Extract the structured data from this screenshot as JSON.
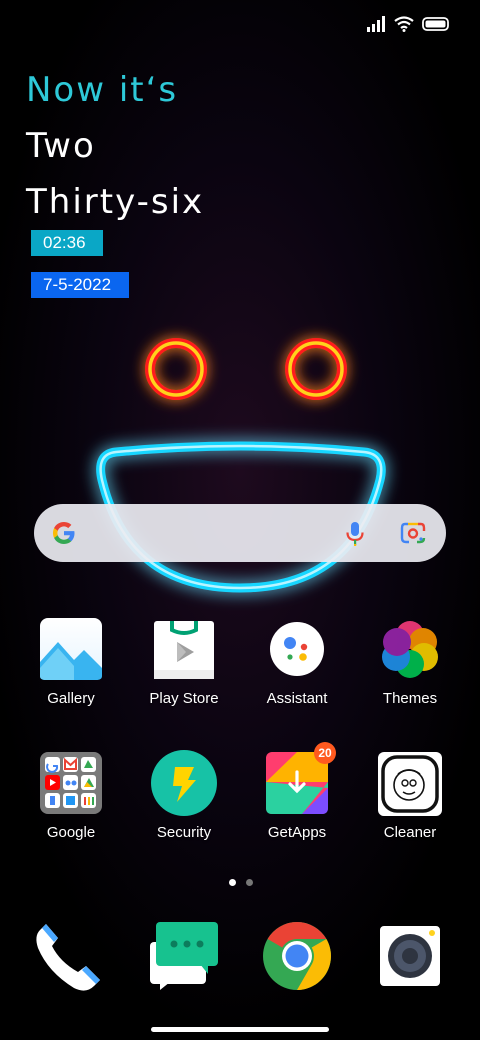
{
  "status_bar": {
    "icons": [
      "signal-icon",
      "wifi-icon",
      "battery-icon"
    ]
  },
  "clock_widget": {
    "line1": "Now it‘s",
    "line2": "Two",
    "line3": "Thirty-six",
    "time": "02:36",
    "date": "7-5-2022"
  },
  "search": {
    "icons": [
      "google-logo-icon",
      "microphone-icon",
      "google-lens-icon"
    ]
  },
  "apps": {
    "row1": [
      {
        "label": "Gallery",
        "icon": "gallery-icon"
      },
      {
        "label": "Play Store",
        "icon": "play-store-icon"
      },
      {
        "label": "Assistant",
        "icon": "assistant-icon"
      },
      {
        "label": "Themes",
        "icon": "themes-icon"
      }
    ],
    "row2": [
      {
        "label": "Google",
        "icon": "google-folder-icon"
      },
      {
        "label": "Security",
        "icon": "security-icon"
      },
      {
        "label": "GetApps",
        "icon": "getapps-icon",
        "badge": "20"
      },
      {
        "label": "Cleaner",
        "icon": "cleaner-icon"
      }
    ]
  },
  "page_indicator": {
    "pages": 2,
    "current": 1
  },
  "dock": [
    {
      "icon": "phone-icon"
    },
    {
      "icon": "messages-icon"
    },
    {
      "icon": "chrome-icon"
    },
    {
      "icon": "camera-icon"
    }
  ],
  "colors": {
    "widget_accent": "#2ec9d8",
    "time_chip": "#0aa7c6",
    "date_chip": "#0a66f0",
    "neon_eyes": "#ff1a1a",
    "neon_smile": "#19d6ff",
    "badge": "#ff5a1f"
  }
}
